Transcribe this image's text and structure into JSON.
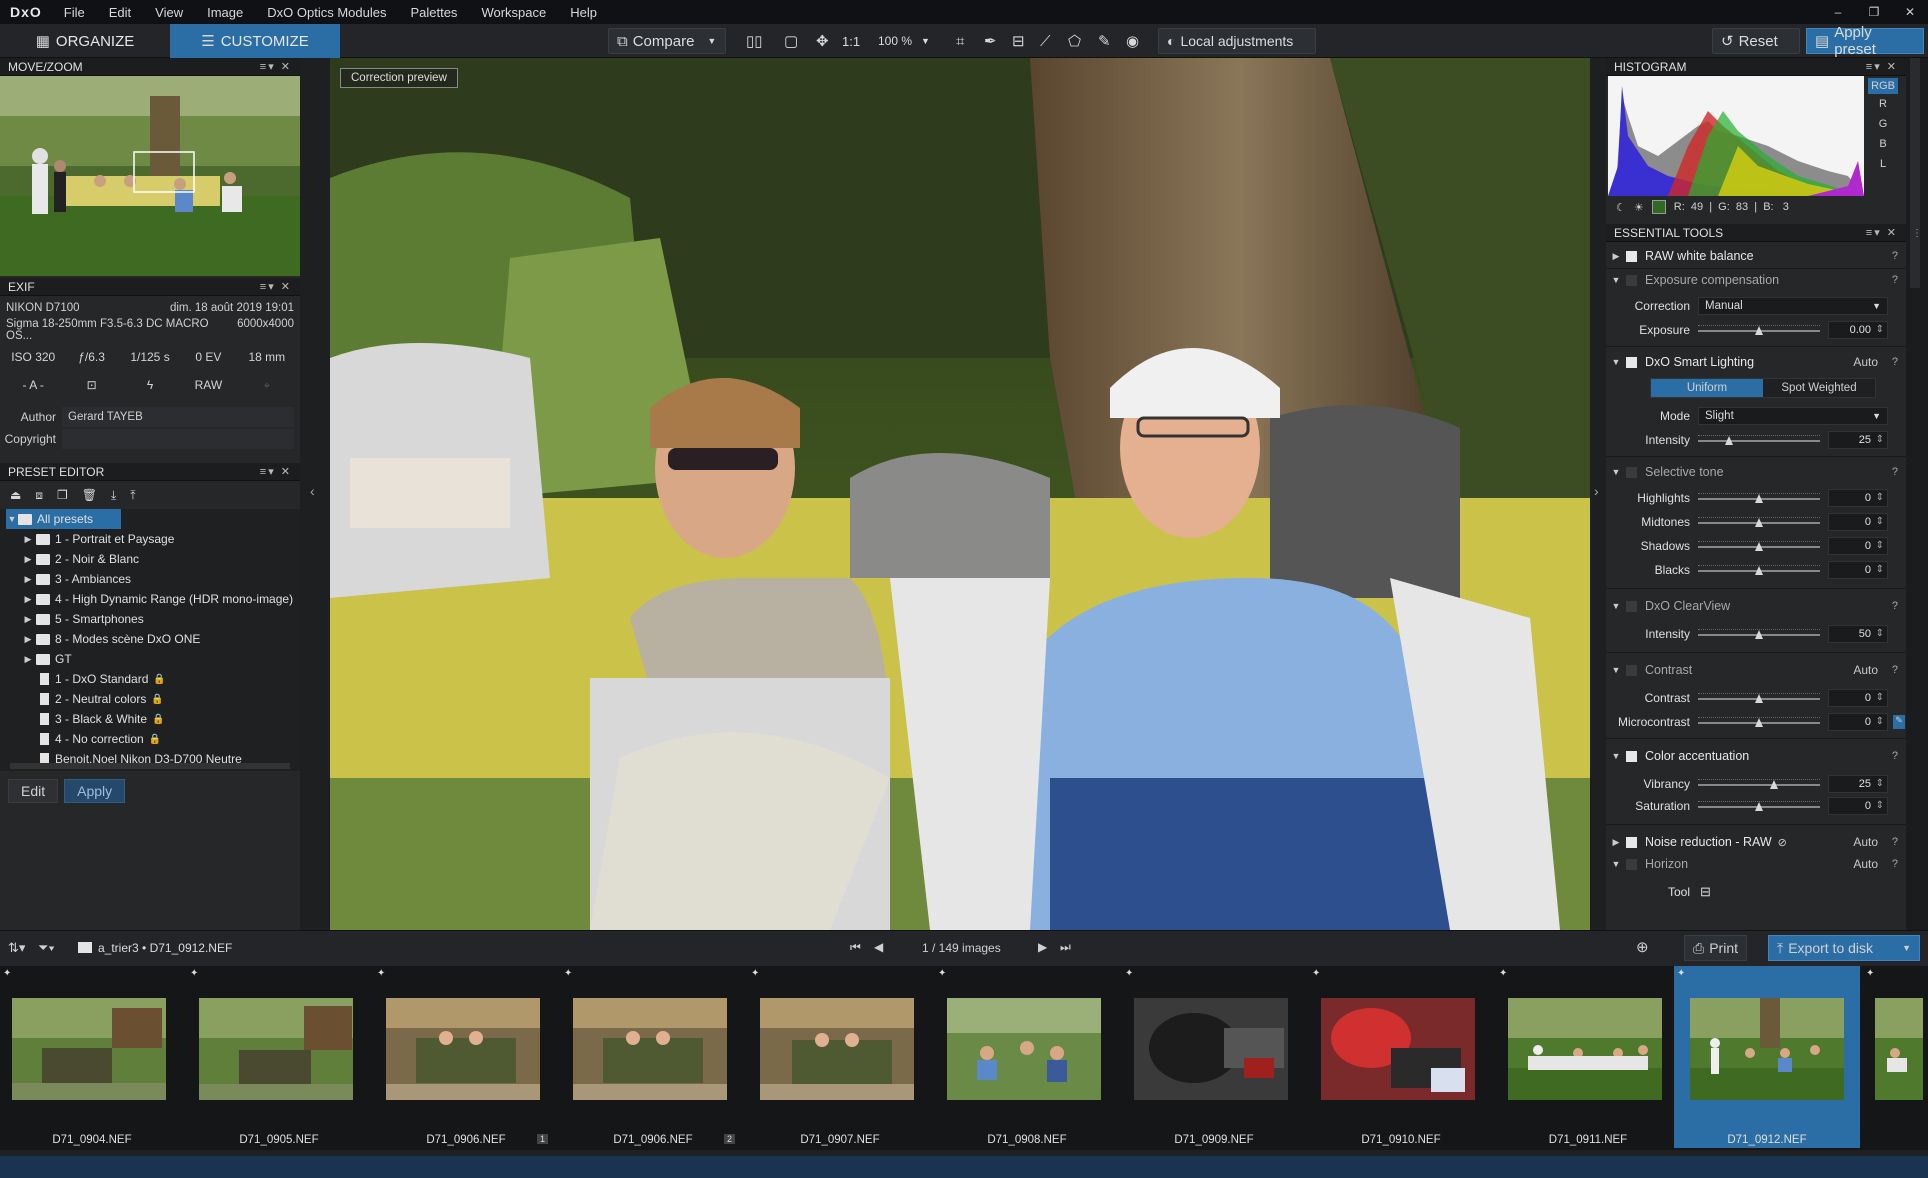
{
  "app": {
    "logo": "DxO",
    "menu": [
      "File",
      "Edit",
      "View",
      "Image",
      "DxO Optics Modules",
      "Palettes",
      "Workspace",
      "Help"
    ],
    "window_controls": [
      "–",
      "❐",
      "✕"
    ]
  },
  "toolbar": {
    "organize": "ORGANIZE",
    "customize": "CUSTOMIZE",
    "compare": "Compare",
    "one_to_one": "1:1",
    "zoom": "100 %",
    "local_adjustments": "Local adjustments",
    "reset": "Reset",
    "apply_preset": "Apply preset"
  },
  "movezoom": {
    "title": "MOVE/ZOOM",
    "controls": "≡▾ ✕"
  },
  "exif": {
    "title": "EXIF",
    "controls": "≡▾ ✕",
    "camera": "NIKON D7100",
    "date": "dim. 18 août 2019 19:01",
    "lens": "Sigma 18-250mm F3.5-6.3 DC MACRO OS...",
    "size": "6000x4000",
    "iso": "ISO 320",
    "aperture": "ƒ/6.3",
    "shutter": "1/125 s",
    "ev": "0 EV",
    "focal": "18 mm",
    "mode": "- A -",
    "raw": "RAW",
    "author_label": "Author",
    "author_value": "Gerard TAYEB",
    "copyright_label": "Copyright",
    "copyright_value": ""
  },
  "preset_editor": {
    "title": "PRESET EDITOR",
    "controls": "≡▾ ✕",
    "root": "All presets",
    "folders": [
      "1 - Portrait et Paysage",
      "2 - Noir & Blanc",
      "3 - Ambiances",
      "4 - High Dynamic Range (HDR mono-image)",
      "5 - Smartphones",
      "8 - Modes scène DxO ONE",
      "GT"
    ],
    "presets": [
      "1 - DxO Standard",
      "2 - Neutral colors",
      "3 - Black & White",
      "4 - No correction",
      "Benoit.Noel Nikon D3-D700 Neutre"
    ],
    "edit": "Edit",
    "apply": "Apply"
  },
  "viewer": {
    "correction_preview": "Correction preview"
  },
  "histogram": {
    "title": "HISTOGRAM",
    "controls": "≡▾ ✕",
    "channels": [
      "RGB",
      "R",
      "G",
      "B",
      "L"
    ],
    "readout": "R:  49  |  G:  83  |  B:   3"
  },
  "essential": {
    "title": "ESSENTIAL TOOLS",
    "controls": "≡▾ ✕",
    "raw_wb": "RAW white balance",
    "exposure_comp": "Exposure compensation",
    "correction_label": "Correction",
    "correction_value": "Manual",
    "exposure_label": "Exposure",
    "exposure_value": "0.00",
    "smart_lighting": "DxO Smart Lighting",
    "smart_auto": "Auto",
    "uniform": "Uniform",
    "spot_weighted": "Spot Weighted",
    "mode_label": "Mode",
    "mode_value": "Slight",
    "intensity_label": "Intensity",
    "intensity_value": "25",
    "selective_tone": "Selective tone",
    "highlights_label": "Highlights",
    "highlights_value": "0",
    "midtones_label": "Midtones",
    "midtones_value": "0",
    "shadows_label": "Shadows",
    "shadows_value": "0",
    "blacks_label": "Blacks",
    "blacks_value": "0",
    "clearview": "DxO ClearView",
    "cv_intensity_label": "Intensity",
    "cv_intensity_value": "50",
    "contrast": "Contrast",
    "contrast_auto": "Auto",
    "contrast_label": "Contrast",
    "contrast_value": "0",
    "micro_label": "Microcontrast",
    "micro_value": "0",
    "color_acc": "Color accentuation",
    "vibrancy_label": "Vibrancy",
    "vibrancy_value": "25",
    "saturation_label": "Saturation",
    "saturation_value": "0",
    "noise": "Noise reduction - RAW",
    "noise_auto": "Auto",
    "horizon": "Horizon",
    "horizon_auto": "Auto",
    "tool_label": "Tool",
    "q": "?"
  },
  "filmbar": {
    "path_folder": "a_trier3",
    "path_sep": "•",
    "path_file": "D71_0912.NEF",
    "counter": "1 / 149",
    "images": "images",
    "print": "Print",
    "export": "Export to disk"
  },
  "filmstrip": [
    {
      "name": "D71_0904.NEF",
      "badge": ""
    },
    {
      "name": "D71_0905.NEF",
      "badge": ""
    },
    {
      "name": "D71_0906.NEF",
      "badge": "1"
    },
    {
      "name": "D71_0906.NEF",
      "badge": "2"
    },
    {
      "name": "D71_0907.NEF",
      "badge": ""
    },
    {
      "name": "D71_0908.NEF",
      "badge": ""
    },
    {
      "name": "D71_0909.NEF",
      "badge": ""
    },
    {
      "name": "D71_0910.NEF",
      "badge": ""
    },
    {
      "name": "D71_0911.NEF",
      "badge": ""
    },
    {
      "name": "D71_0912.NEF",
      "badge": "",
      "selected": true
    }
  ],
  "colors": {
    "accent": "#2a6ea5",
    "panel": "#262729",
    "background": "#1e1f21"
  }
}
